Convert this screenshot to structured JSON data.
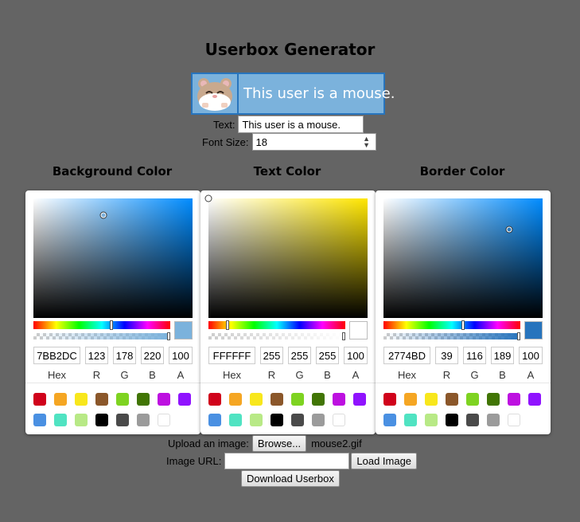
{
  "title": "Userbox Generator",
  "userbox": {
    "text": "This user is a mouse.",
    "image": "hamster-image"
  },
  "form": {
    "text_label": "Text:",
    "text_value": "This user is a mouse.",
    "font_size_label": "Font Size:",
    "font_size_value": "18"
  },
  "pickers": [
    {
      "heading": "Background Color",
      "hex": "7BB2DC",
      "r": "123",
      "g": "178",
      "b": "220",
      "a": "100",
      "color": "#7BB2DC",
      "hue_color": "#008cff",
      "hue_fraction": 0.57,
      "sat_fraction": 0.44,
      "val_fraction": 0.86
    },
    {
      "heading": "Text Color",
      "hex": "FFFFFF",
      "r": "255",
      "g": "255",
      "b": "255",
      "a": "100",
      "color": "#FFFFFF",
      "hue_color": "#ffe600",
      "hue_fraction": 0.14,
      "sat_fraction": 0.0,
      "val_fraction": 1.0
    },
    {
      "heading": "Border Color",
      "hex": "2774BD",
      "r": "39",
      "g": "116",
      "b": "189",
      "a": "100",
      "color": "#2774BD",
      "hue_color": "#008cff",
      "hue_fraction": 0.58,
      "sat_fraction": 0.79,
      "val_fraction": 0.74
    }
  ],
  "field_labels": {
    "hex": "Hex",
    "r": "R",
    "g": "G",
    "b": "B",
    "a": "A"
  },
  "swatches": [
    "#d0021b",
    "#f5a623",
    "#f8e71c",
    "#8b572a",
    "#7ed321",
    "#417505",
    "#bd10e0",
    "#9013fe",
    "#4a90e2",
    "#50e3c2",
    "#b8e986",
    "#000000",
    "#4a4a4a",
    "#9b9b9b",
    "#ffffff"
  ],
  "upload": {
    "label": "Upload an image:",
    "button": "Browse...",
    "filename": "mouse2.gif"
  },
  "url": {
    "label": "Image URL:",
    "value": "",
    "button": "Load Image"
  },
  "download_button": "Download Userbox"
}
